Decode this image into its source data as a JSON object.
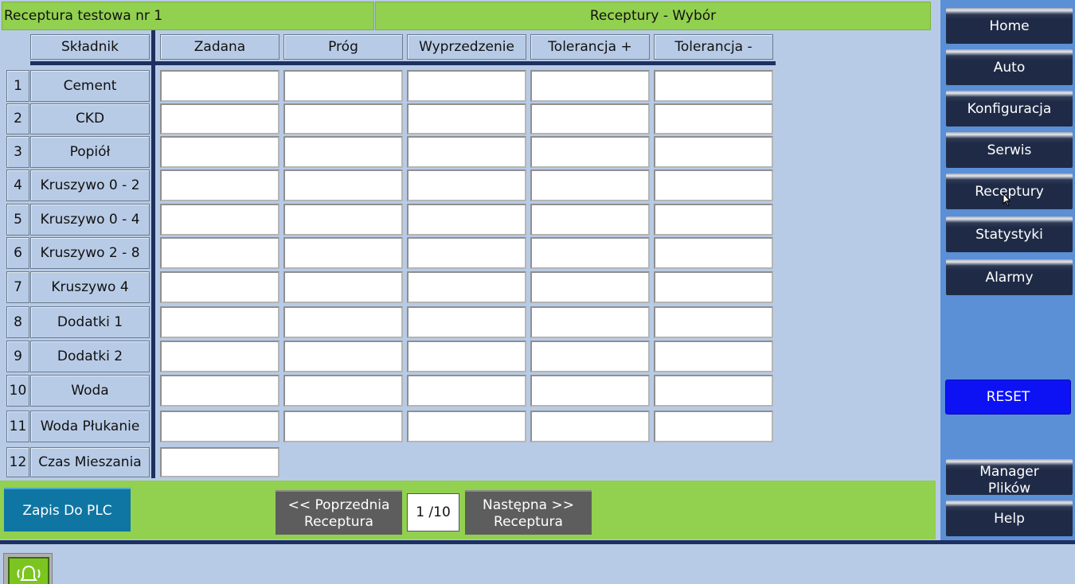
{
  "header": {
    "recipe_name": "Receptura testowa nr 1",
    "screen_title": "Receptury - Wybór"
  },
  "table": {
    "columns": [
      "Składnik",
      "Zadana",
      "Próg",
      "Wyprzedzenie",
      "Tolerancja +",
      "Tolerancja -"
    ],
    "rows": [
      {
        "num": "1",
        "name": "Cement"
      },
      {
        "num": "2",
        "name": "CKD"
      },
      {
        "num": "3",
        "name": "Popiół"
      },
      {
        "num": "4",
        "name": "Kruszywo 0 - 2"
      },
      {
        "num": "5",
        "name": "Kruszywo 0 - 4"
      },
      {
        "num": "6",
        "name": "Kruszywo 2 - 8"
      },
      {
        "num": "7",
        "name": "Kruszywo 4"
      },
      {
        "num": "8",
        "name": "Dodatki 1"
      },
      {
        "num": "9",
        "name": "Dodatki 2"
      },
      {
        "num": "10",
        "name": "Woda"
      },
      {
        "num": "11",
        "name": "Woda Płukanie"
      },
      {
        "num": "12",
        "name": "Czas Mieszania"
      }
    ]
  },
  "footer": {
    "save_label": "Zapis Do PLC",
    "prev_line1": "<< Poprzednia",
    "prev_line2": "Receptura",
    "page_indicator": "1 /10",
    "next_line1": "Następna >>",
    "next_line2": "Receptura"
  },
  "nav": {
    "home": "Home",
    "auto": "Auto",
    "config": "Konfiguracja",
    "service": "Serwis",
    "recipes": "Receptury",
    "stats": "Statystyki",
    "alarms": "Alarmy",
    "reset": "RESET",
    "files_line1": "Manager",
    "files_line2": "Plików",
    "help": "Help"
  },
  "icons": {
    "alarm": "alarm-bell-icon",
    "cursor": "mouse-pointer-icon"
  },
  "colors": {
    "background": "#b8cbe6",
    "green_bar": "#92d050",
    "navy": "#1d3060",
    "reset_blue": "#0d12f5",
    "save_blue": "#0f76a3"
  }
}
